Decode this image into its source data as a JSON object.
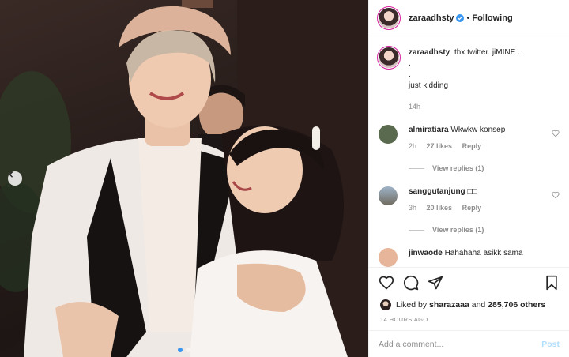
{
  "post": {
    "author": "zaraadhsty",
    "separator": "•",
    "follow_label": "Following",
    "caption_lines": [
      "thx twitter. jiMINE .",
      ".",
      ".",
      "just kidding"
    ],
    "caption_time": "14h"
  },
  "comments": [
    {
      "user": "almiratiara",
      "text": "Wkwkw konsep",
      "time": "2h",
      "likes": "27 likes",
      "reply": "Reply",
      "view_replies": "View replies (1)",
      "avatar_color": "#5a6a4e"
    },
    {
      "user": "sanggutanjung",
      "text": "□□",
      "time": "3h",
      "likes": "20 likes",
      "reply": "Reply",
      "view_replies": "View replies (1)",
      "avatar_color": "#7d8a96"
    },
    {
      "user": "jinwaode",
      "text": "Hahahaha asikk sama",
      "avatar_color": "#e7b59a"
    }
  ],
  "likes": {
    "liked_by": "Liked by",
    "user": "sharazaaa",
    "and": "and",
    "count": "285,706 others"
  },
  "timestamp": "14 HOURS AGO",
  "add_comment": {
    "placeholder": "Add a comment...",
    "post_label": "Post"
  },
  "colors": {
    "verified": "#3897f0",
    "post_disabled": "#b2dffc",
    "muted": "#8e8e8e"
  },
  "carousel": {
    "current": 1,
    "total": 2
  }
}
